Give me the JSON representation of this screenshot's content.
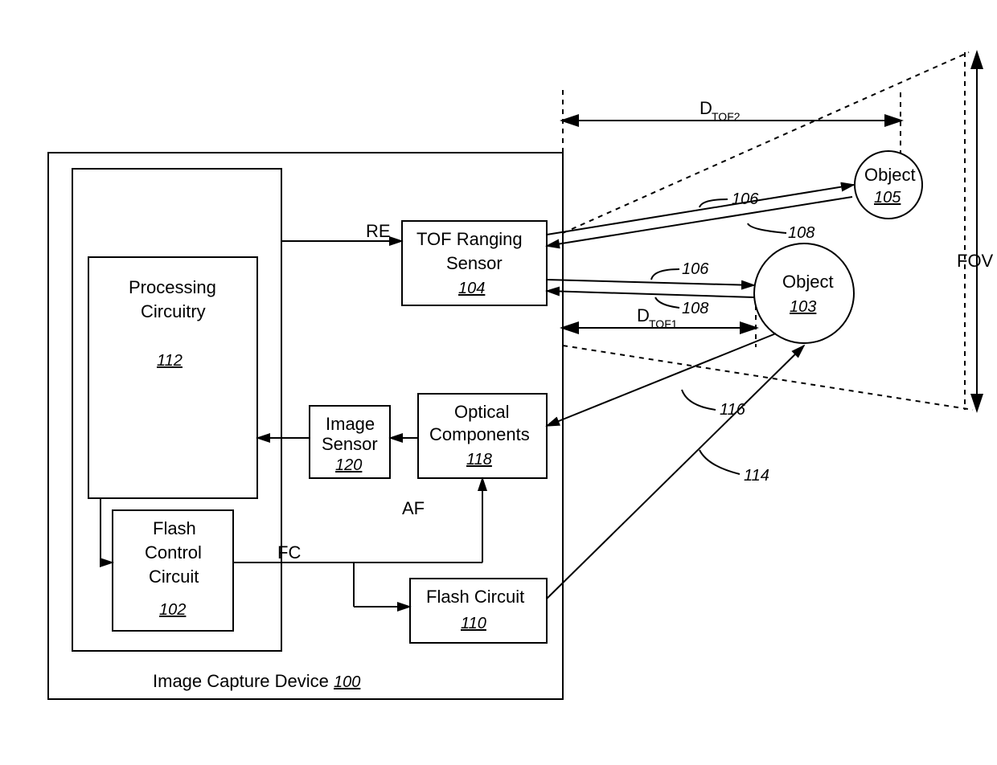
{
  "diagram": {
    "device_label": "Image Capture Device",
    "device_ref": "100",
    "blocks": {
      "processing": {
        "title_l1": "Processing",
        "title_l2": "Circuitry",
        "ref": "112"
      },
      "flash_control": {
        "title_l1": "Flash",
        "title_l2": "Control",
        "title_l3": "Circuit",
        "ref": "102"
      },
      "tof_sensor": {
        "title_l1": "TOF Ranging",
        "title_l2": "Sensor",
        "ref": "104"
      },
      "image_sensor": {
        "title_l1": "Image",
        "title_l2": "Sensor",
        "ref": "120"
      },
      "optical": {
        "title_l1": "Optical",
        "title_l2": "Components",
        "ref": "118"
      },
      "flash_circuit": {
        "title_l1": "Flash Circuit",
        "ref": "110"
      }
    },
    "objects": {
      "obj1": {
        "label": "Object",
        "ref": "103"
      },
      "obj2": {
        "label": "Object",
        "ref": "105"
      }
    },
    "signals": {
      "re": "RE",
      "af": "AF",
      "fc": "FC"
    },
    "distances": {
      "d_tof1_base": "D",
      "d_tof1_sub": "TOF1",
      "d_tof2_base": "D",
      "d_tof2_sub": "TOF2"
    },
    "fov_label": "FOV",
    "ray_refs": {
      "r106": "106",
      "r108": "108",
      "r114": "114",
      "r116": "116"
    }
  }
}
